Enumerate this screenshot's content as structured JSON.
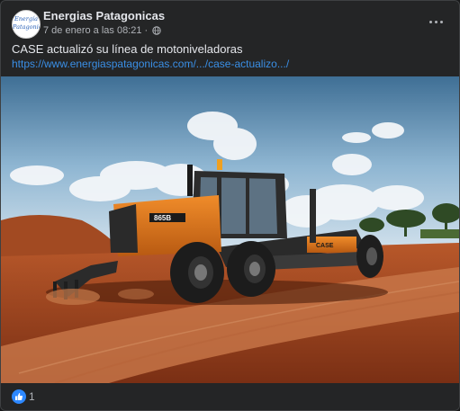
{
  "post": {
    "page_name": "Energias Patagonicas",
    "avatar_text_line1": "Energía",
    "avatar_text_line2": "Patagonica",
    "timestamp": "7 de enero a las 08:21",
    "separator": "·",
    "privacy_icon": "globe-icon",
    "more_icon": "ellipsis-icon",
    "text": "CASE actualizó su línea de motoniveladoras",
    "link": "https://www.energiaspatagonicas.com/.../case-actualizo.../",
    "image": {
      "description_icon": "photo",
      "brand_label": "CASE",
      "model_label": "865B"
    },
    "reactions": {
      "icon": "like-icon",
      "count": "1"
    }
  },
  "colors": {
    "background": "#242526",
    "text": "#e4e6eb",
    "secondary_text": "#b0b3b8",
    "link": "#3a8fe6",
    "like": "#2d88ff",
    "machine_orange": "#e07b1f"
  }
}
